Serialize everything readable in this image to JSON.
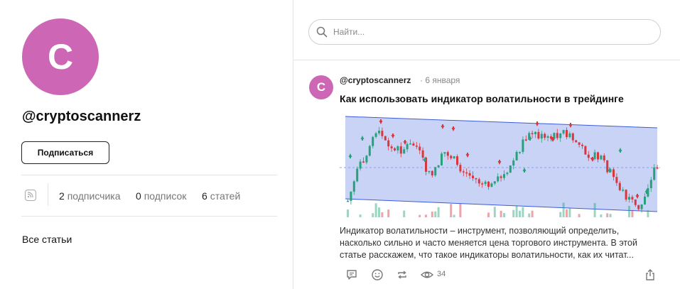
{
  "profile": {
    "avatar_letter": "C",
    "handle": "@cryptoscannerz",
    "subscribe_label": "Подписаться",
    "stats": {
      "subscribers_count": "2",
      "subscribers_label": "подписчика",
      "following_count": "0",
      "following_label": "подписок",
      "articles_count": "6",
      "articles_label": "статей"
    },
    "all_articles_label": "Все статьи"
  },
  "search": {
    "placeholder": "Найти..."
  },
  "post": {
    "avatar_letter": "C",
    "author": "@cryptoscannerz",
    "date": "· 6 января",
    "title": "Как использовать индикатор волатильности в трейдинге",
    "excerpt": "Индикатор волатильности – инструмент, позволяющий определить, насколько сильно и часто меняется цена торгового инструмента. В этой статье расскажем, что такое индикаторы волатильности, как их читат...",
    "views": "34"
  },
  "icons": {
    "rss": "rss-icon",
    "search": "search-icon",
    "comment": "comment-icon",
    "reaction": "smile-icon",
    "repost": "repost-icon",
    "views": "eye-icon",
    "share": "share-icon"
  },
  "colors": {
    "avatar": "#cd67b5",
    "candle_up": "#26a17b",
    "candle_down": "#d9363e",
    "channel_fill": "#c9d3f5",
    "channel_line": "#3b5bdb"
  }
}
